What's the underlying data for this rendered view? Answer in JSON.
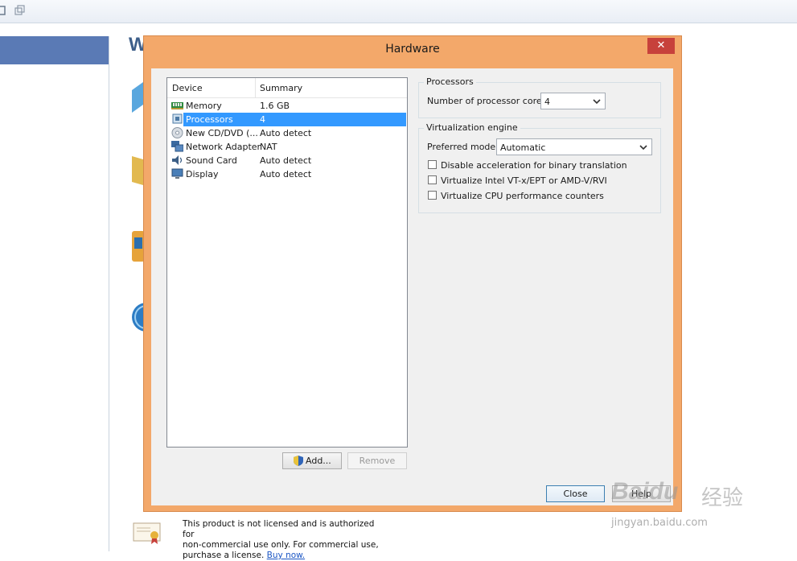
{
  "background": {
    "heading_partial": "W",
    "license_text_line1": "This product is not licensed and is authorized for",
    "license_text_line2": "non-commercial use only. For commercial use,",
    "license_text_line3": "purchase a license.",
    "buy_link": "Buy now."
  },
  "dialog": {
    "title": "Hardware",
    "close_glyph": "✕"
  },
  "device_list": {
    "columns": [
      "Device",
      "Summary"
    ],
    "rows": [
      {
        "name": "Memory",
        "summary": "1.6 GB",
        "icon": "memory-icon"
      },
      {
        "name": "Processors",
        "summary": "4",
        "icon": "processor-icon",
        "selected": true
      },
      {
        "name": "New CD/DVD (...",
        "summary": "Auto detect",
        "icon": "cd-dvd-icon"
      },
      {
        "name": "Network Adapter",
        "summary": "NAT",
        "icon": "network-adapter-icon"
      },
      {
        "name": "Sound Card",
        "summary": "Auto detect",
        "icon": "sound-card-icon"
      },
      {
        "name": "Display",
        "summary": "Auto detect",
        "icon": "display-icon"
      }
    ],
    "add_button": "Add...",
    "remove_button": "Remove"
  },
  "processors": {
    "legend": "Processors",
    "cores_label": "Number of processor cores:",
    "cores_value": "4"
  },
  "virtualization": {
    "legend": "Virtualization engine",
    "mode_label": "Preferred mode:",
    "mode_value": "Automatic",
    "options": [
      {
        "label": "Disable acceleration for binary translation",
        "checked": false
      },
      {
        "label": "Virtualize Intel VT-x/EPT or AMD-V/RVI",
        "checked": false
      },
      {
        "label": "Virtualize CPU performance counters",
        "checked": false
      }
    ]
  },
  "footer": {
    "close_button": "Close",
    "help_button": "Help"
  },
  "watermark": {
    "logo": "Baidu",
    "jingyan": "经验",
    "url": "jingyan.baidu.com"
  },
  "colors": {
    "dialog_frame": "#f3a86a",
    "selection": "#3399ff",
    "close_button": "#c7413b"
  }
}
